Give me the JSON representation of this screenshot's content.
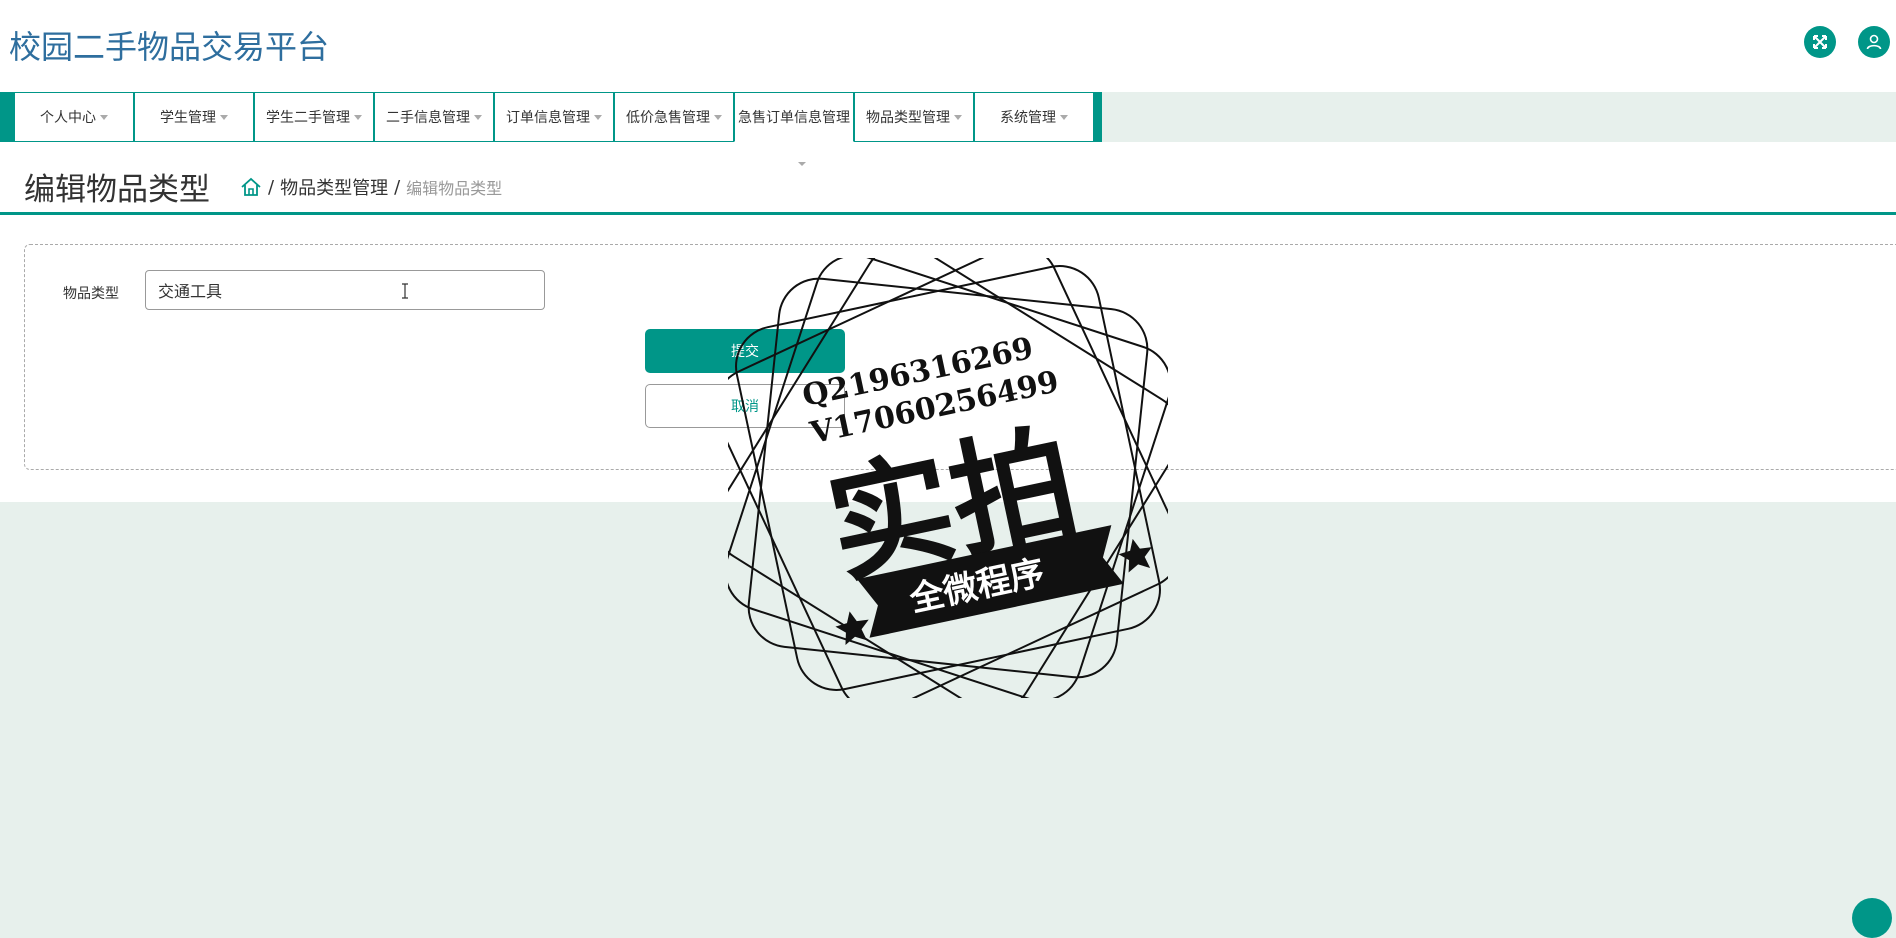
{
  "app": {
    "title": "校园二手物品交易平台"
  },
  "header": {
    "fullscreen_icon": "fullscreen-icon",
    "user_icon": "user-icon",
    "accent_color": "#009688"
  },
  "nav": {
    "items": [
      {
        "label": "个人中心"
      },
      {
        "label": "学生管理"
      },
      {
        "label": "学生二手管理"
      },
      {
        "label": "二手信息管理"
      },
      {
        "label": "订单信息管理"
      },
      {
        "label": "低价急售管理"
      },
      {
        "label": "急售订单信息管理"
      },
      {
        "label": "物品类型管理"
      },
      {
        "label": "系统管理"
      }
    ],
    "active_index": 6
  },
  "page": {
    "title": "编辑物品类型",
    "breadcrumb": {
      "home_icon": "home-icon",
      "sep": "/",
      "parent": "物品类型管理",
      "current": "编辑物品类型"
    }
  },
  "form": {
    "field_label": "物品类型",
    "field_value": "交通工具",
    "submit_label": "提交",
    "cancel_label": "取消"
  },
  "watermark": {
    "line1": "Q2196316269",
    "line2": "V17060256499",
    "big_text": "实拍",
    "banner_text": "全微程序"
  }
}
